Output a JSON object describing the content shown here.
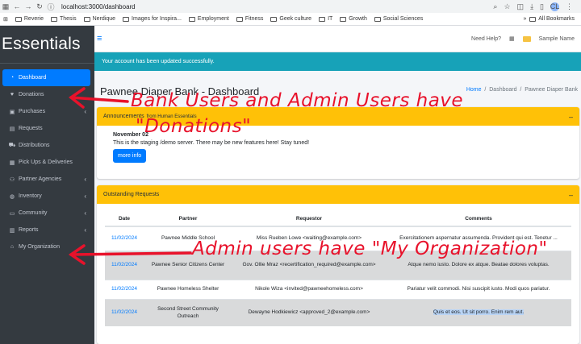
{
  "browser": {
    "url": "localhost:3000/dashboard",
    "bookmarks": [
      "Reverie",
      "Thesis",
      "Nerdique",
      "Images for Inspira...",
      "Employment",
      "Fitness",
      "Geek culture",
      "IT",
      "Growth",
      "Social Sciences"
    ],
    "all_bookmarks": "All Bookmarks",
    "profile_initials": "CL"
  },
  "sidebar": {
    "brand": "Essentials",
    "items": [
      {
        "label": "Dashboard",
        "icon": "tachometer-icon"
      },
      {
        "label": "Donations",
        "icon": "heart-icon"
      },
      {
        "label": "Purchases",
        "icon": "money-icon"
      },
      {
        "label": "Requests",
        "icon": "file-icon"
      },
      {
        "label": "Distributions",
        "icon": "cart-icon"
      },
      {
        "label": "Pick Ups & Deliveries",
        "icon": "calendar-icon"
      },
      {
        "label": "Partner Agencies",
        "icon": "users-icon"
      },
      {
        "label": "Inventory",
        "icon": "globe-icon"
      },
      {
        "label": "Community",
        "icon": "laptop-icon"
      },
      {
        "label": "Reports",
        "icon": "chart-icon"
      },
      {
        "label": "My Organization",
        "icon": "home-icon"
      }
    ]
  },
  "topnav": {
    "help": "Need Help?",
    "user": "Sample Name"
  },
  "alert": "Your account has been updated successfully.",
  "page": {
    "title": "Pawnee Diaper Bank - Dashboard",
    "breadcrumb": [
      "Home",
      "Dashboard",
      "Pawnee Diaper Bank"
    ]
  },
  "announcements": {
    "title": "Announcements",
    "subtitle": "from Human Essentials",
    "date": "November 02",
    "text": "This is the staging /demo server. There may be new features here! Stay tuned!",
    "button": "more info"
  },
  "requests": {
    "title": "Outstanding Requests",
    "columns": [
      "Date",
      "Partner",
      "Requestor",
      "Comments"
    ],
    "rows": [
      {
        "date": "11/02/2024",
        "partner": "Pawnee Middle School",
        "requestor": "Miss Rueben Lowe <waiting@example.com>",
        "comments": "Exercitationem aspernatur assumenda. Provident qui est. Tenetur ..."
      },
      {
        "date": "11/02/2024",
        "partner": "Pawnee Senior Citizens Center",
        "requestor": "Gov. Ollie Mraz <recertification_required@example.com>",
        "comments": "Atque nemo iusto. Dolore ex atque. Beatae dolores voluptas."
      },
      {
        "date": "11/02/2024",
        "partner": "Pawnee Homeless Shelter",
        "requestor": "Nikole Wiza <invited@pawneehomeless.com>",
        "comments": "Pariatur velit commodi. Nisi suscipit iusto. Modi quos pariatur."
      },
      {
        "date": "11/02/2024",
        "partner": "Second Street Community Outreach",
        "requestor": "Dewayne Hodkiewicz <approved_2@example.com>",
        "comments": "Quis et eos. Ut sit porro. Enim rem aut."
      }
    ]
  },
  "annotations": {
    "donations_line1": "Bank Users and Admin Users have",
    "donations_line2": "\"Donations\"",
    "organization": "Admin users have \"My Organization\"",
    "color": "#e8122b"
  }
}
